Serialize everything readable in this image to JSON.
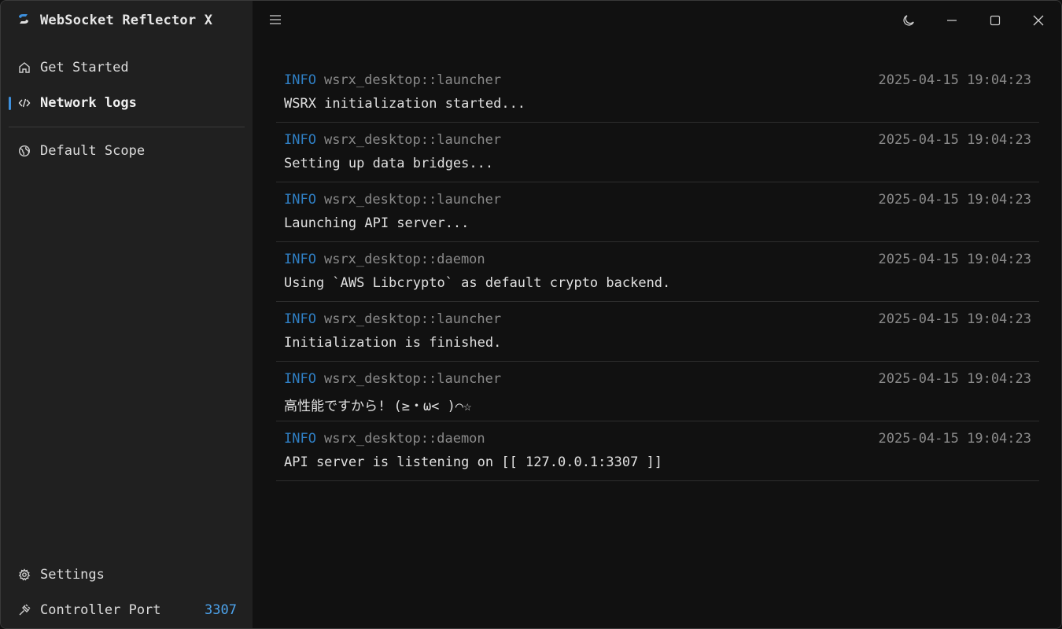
{
  "app": {
    "title": "WebSocket Reflector X"
  },
  "sidebar": {
    "items": [
      {
        "label": "Get Started",
        "icon": "home-icon"
      },
      {
        "label": "Network logs",
        "icon": "code-icon",
        "active": true
      },
      {
        "label": "Default Scope",
        "icon": "globe-icon"
      }
    ],
    "settings_label": "Settings",
    "controller_port_label": "Controller Port",
    "controller_port_value": "3307"
  },
  "logs": [
    {
      "level": "INFO",
      "target": "wsrx_desktop::launcher",
      "time": "2025-04-15 19:04:23",
      "message": "WSRX initialization started..."
    },
    {
      "level": "INFO",
      "target": "wsrx_desktop::launcher",
      "time": "2025-04-15 19:04:23",
      "message": "Setting up data bridges..."
    },
    {
      "level": "INFO",
      "target": "wsrx_desktop::launcher",
      "time": "2025-04-15 19:04:23",
      "message": "Launching API server..."
    },
    {
      "level": "INFO",
      "target": "wsrx_desktop::daemon",
      "time": "2025-04-15 19:04:23",
      "message": "Using `AWS Libcrypto` as default crypto backend."
    },
    {
      "level": "INFO",
      "target": "wsrx_desktop::launcher",
      "time": "2025-04-15 19:04:23",
      "message": "Initialization is finished."
    },
    {
      "level": "INFO",
      "target": "wsrx_desktop::launcher",
      "time": "2025-04-15 19:04:23",
      "message": "高性能ですから! (≥・ω< )⌒☆"
    },
    {
      "level": "INFO",
      "target": "wsrx_desktop::daemon",
      "time": "2025-04-15 19:04:23",
      "message": "API server is listening on [[ 127.0.0.1:3307 ]]"
    }
  ],
  "colors": {
    "accent": "#3d8fdc",
    "info": "#2f7fc4",
    "port": "#4da3ec"
  }
}
